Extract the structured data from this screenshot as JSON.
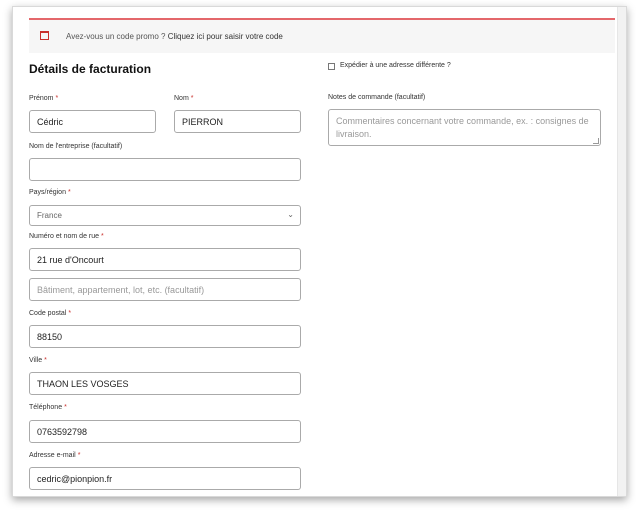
{
  "notice": {
    "text": "Avez-vous un code promo ?",
    "link": "Cliquez ici pour saisir votre code"
  },
  "billing": {
    "title": "Détails de facturation",
    "required_mark": "*",
    "first_name": {
      "label": "Prénom",
      "value": "Cédric"
    },
    "last_name": {
      "label": "Nom",
      "value": "PIERRON"
    },
    "company": {
      "label": "Nom de l'entreprise (facultatif)",
      "value": ""
    },
    "country": {
      "label": "Pays/région",
      "value": "France"
    },
    "street": {
      "label": "Numéro et nom de rue",
      "value": "21 rue d'Oncourt"
    },
    "address2": {
      "placeholder": "Bâtiment, appartement, lot, etc. (facultatif)"
    },
    "postcode": {
      "label": "Code postal",
      "value": "88150"
    },
    "city": {
      "label": "Ville",
      "value": "THAON LES VOSGES"
    },
    "phone": {
      "label": "Téléphone",
      "value": "0763592798"
    },
    "email": {
      "label": "Adresse e-mail",
      "value": "cedric@pionpion.fr"
    }
  },
  "shipping": {
    "checkbox_label": "Expédier à une adresse différente ?",
    "checked": false
  },
  "order_notes": {
    "label": "Notes de commande (facultatif)",
    "placeholder": "Commentaires concernant votre commande, ex. : consignes de livraison."
  },
  "colors": {
    "accent": "#e4676b",
    "required": "#c9302c"
  }
}
